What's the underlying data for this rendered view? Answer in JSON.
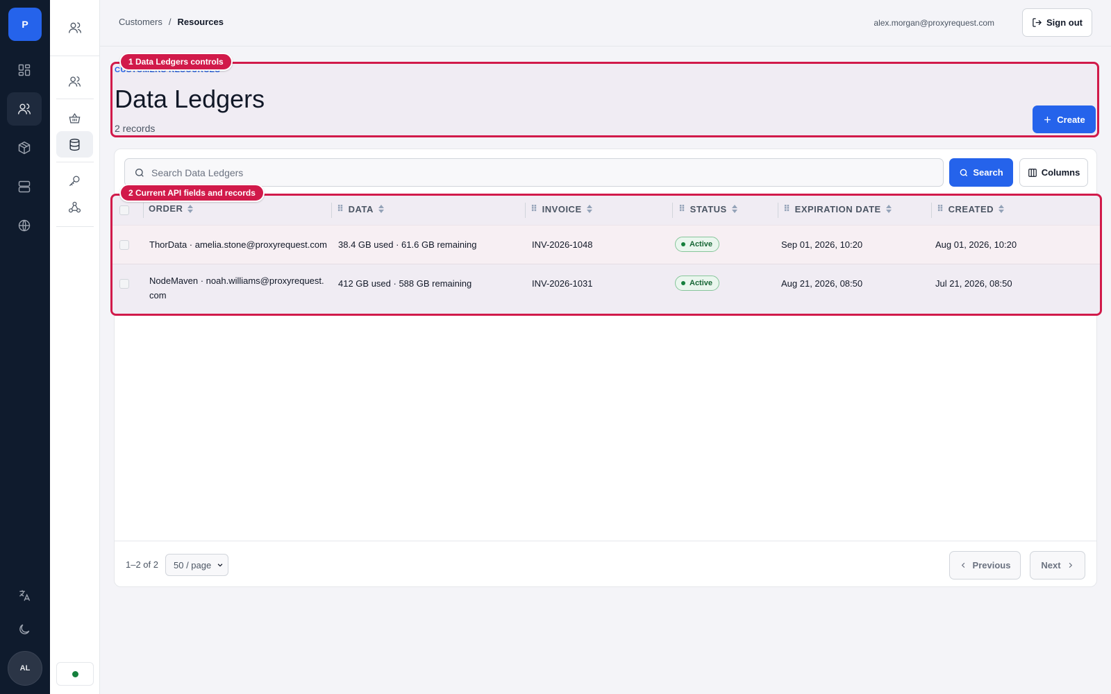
{
  "app": {
    "logo_letter": "P",
    "user_initials": "AL"
  },
  "rail": {
    "icons": [
      "dashboard-icon",
      "users-icon",
      "package-icon",
      "server-icon",
      "globe-icon"
    ],
    "bottom_icons": [
      "translate-icon",
      "moon-icon"
    ]
  },
  "subnav": {
    "icons": [
      "users-icon",
      "basket-icon",
      "database-icon",
      "key-icon",
      "webhook-icon"
    ]
  },
  "breadcrumb": {
    "parent": "Customers",
    "separator": "/",
    "current": "Resources"
  },
  "header": {
    "user_email": "alex.morgan@proxyrequest.com",
    "signout_label": "Sign out"
  },
  "page": {
    "eyebrow": "CUSTOMERS RESOURCES",
    "title": "Data Ledgers",
    "record_count": "2 records",
    "create_label": "Create"
  },
  "search": {
    "placeholder": "Search Data Ledgers",
    "button_label": "Search",
    "columns_label": "Columns"
  },
  "table": {
    "columns": [
      "ORDER",
      "DATA",
      "INVOICE",
      "STATUS",
      "EXPIRATION DATE",
      "CREATED"
    ],
    "rows": [
      {
        "order": "ThorData · amelia.stone@proxyrequest.com",
        "data": "38.4 GB used · 61.6 GB remaining",
        "invoice": "INV-2026-1048",
        "status": "Active",
        "expiration": "Sep 01, 2026, 10:20",
        "created": "Aug 01, 2026, 10:20"
      },
      {
        "order": "NodeMaven · noah.williams@proxyrequest.com",
        "data": "412 GB used · 588 GB remaining",
        "invoice": "INV-2026-1031",
        "status": "Active",
        "expiration": "Aug 21, 2026, 08:50",
        "created": "Jul 21, 2026, 08:50"
      }
    ]
  },
  "pagination": {
    "range": "1–2 of 2",
    "page_size": "50 / page",
    "previous_label": "Previous",
    "next_label": "Next"
  },
  "annotations": [
    {
      "number": "1",
      "label": "1 Data Ledgers controls"
    },
    {
      "number": "2",
      "label": "2 Current API fields and records"
    }
  ],
  "colors": {
    "accent": "#2563eb",
    "rail_bg": "#0f1b2d",
    "highlight": "#d11a4a",
    "status_active": "#15803d"
  }
}
